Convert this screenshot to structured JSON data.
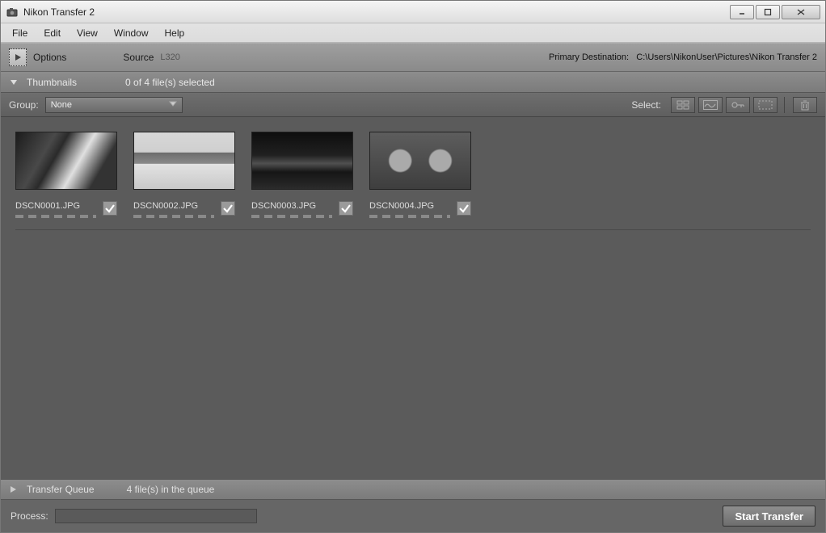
{
  "window": {
    "title": "Nikon Transfer 2"
  },
  "menubar": {
    "items": [
      "File",
      "Edit",
      "View",
      "Window",
      "Help"
    ]
  },
  "options": {
    "label": "Options",
    "source_label": "Source",
    "source_value": "L320",
    "dest_label": "Primary Destination:",
    "dest_value": "C:\\Users\\NikonUser\\Pictures\\Nikon Transfer 2"
  },
  "thumbnails": {
    "label": "Thumbnails",
    "count_text": "0 of 4 file(s) selected",
    "group_label": "Group:",
    "group_value": "None",
    "select_label": "Select:",
    "items": [
      {
        "filename": "DSCN0001.JPG",
        "checked": true
      },
      {
        "filename": "DSCN0002.JPG",
        "checked": true
      },
      {
        "filename": "DSCN0003.JPG",
        "checked": true
      },
      {
        "filename": "DSCN0004.JPG",
        "checked": true
      }
    ]
  },
  "queue": {
    "label": "Transfer Queue",
    "status": "4 file(s) in the queue"
  },
  "bottom": {
    "process_label": "Process:",
    "start_label": "Start Transfer"
  }
}
